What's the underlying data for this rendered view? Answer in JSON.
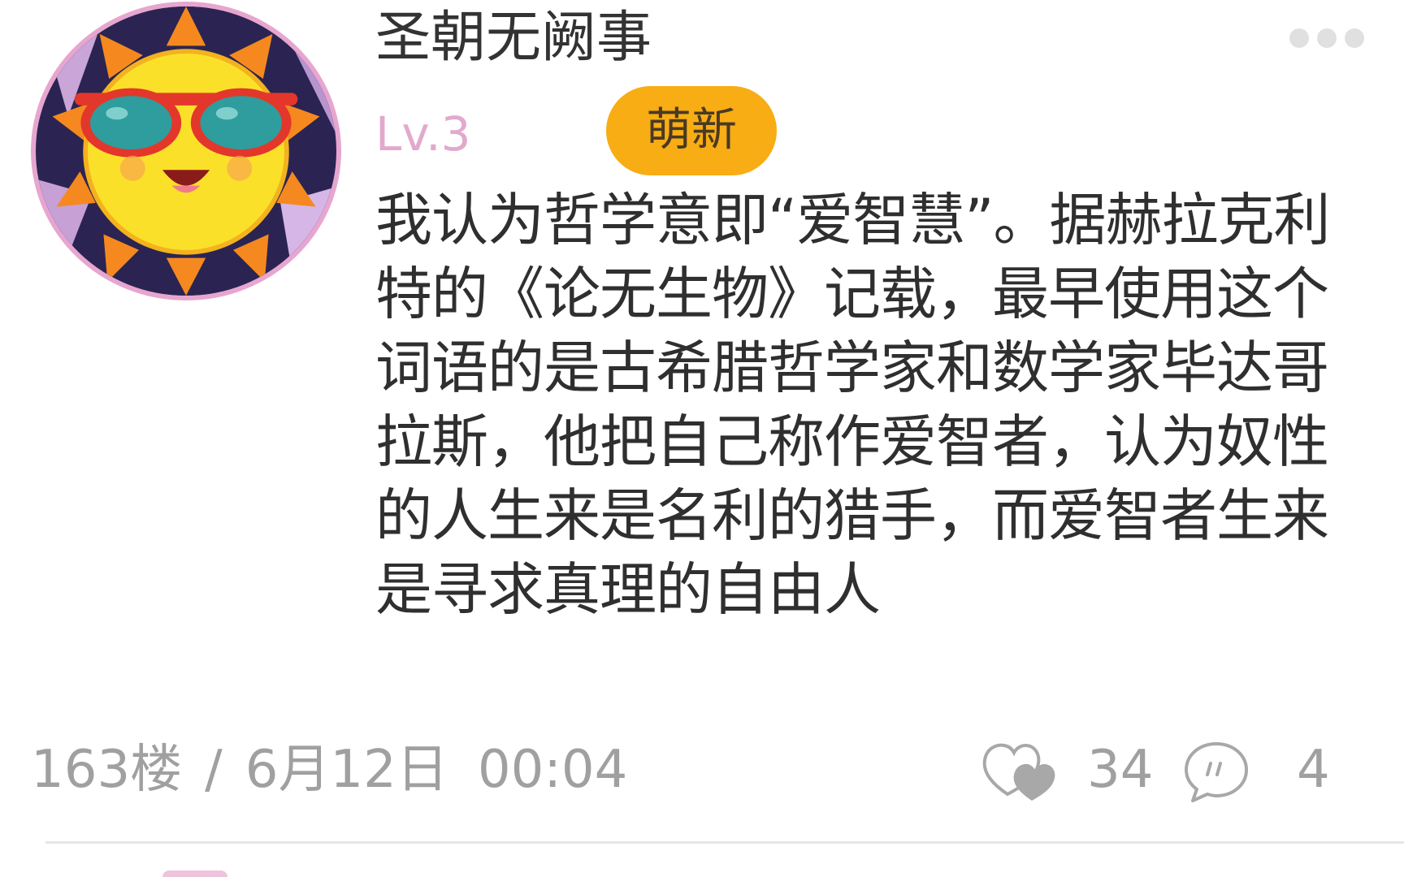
{
  "post": {
    "username": "圣朝无阙事",
    "level": "Lv.3",
    "badge": "萌新",
    "content": "我认为哲学意即“爱智慧”。据赫拉克利特的《论无生物》记载，最早使用这个词语的是古希腊哲学家和数学家毕达哥拉斯，他把自己称作爱智者，认为奴性的人生来是名利的猎手，而爱智者生来是寻求真理的自由人",
    "floor": "163楼",
    "separator": "/",
    "date": "6月12日",
    "time": "00:04",
    "likes": "34",
    "comments": "4"
  },
  "icons": {
    "more": "more-dots-icon",
    "like": "heart-icon",
    "comment": "comment-bubble-icon",
    "avatar": "sun-with-sunglasses-avatar"
  },
  "colors": {
    "level": "#e3a9cc",
    "badge": "#f8ad14",
    "meta": "#a0a0a0",
    "avatar_border": "#e7a6cf"
  }
}
